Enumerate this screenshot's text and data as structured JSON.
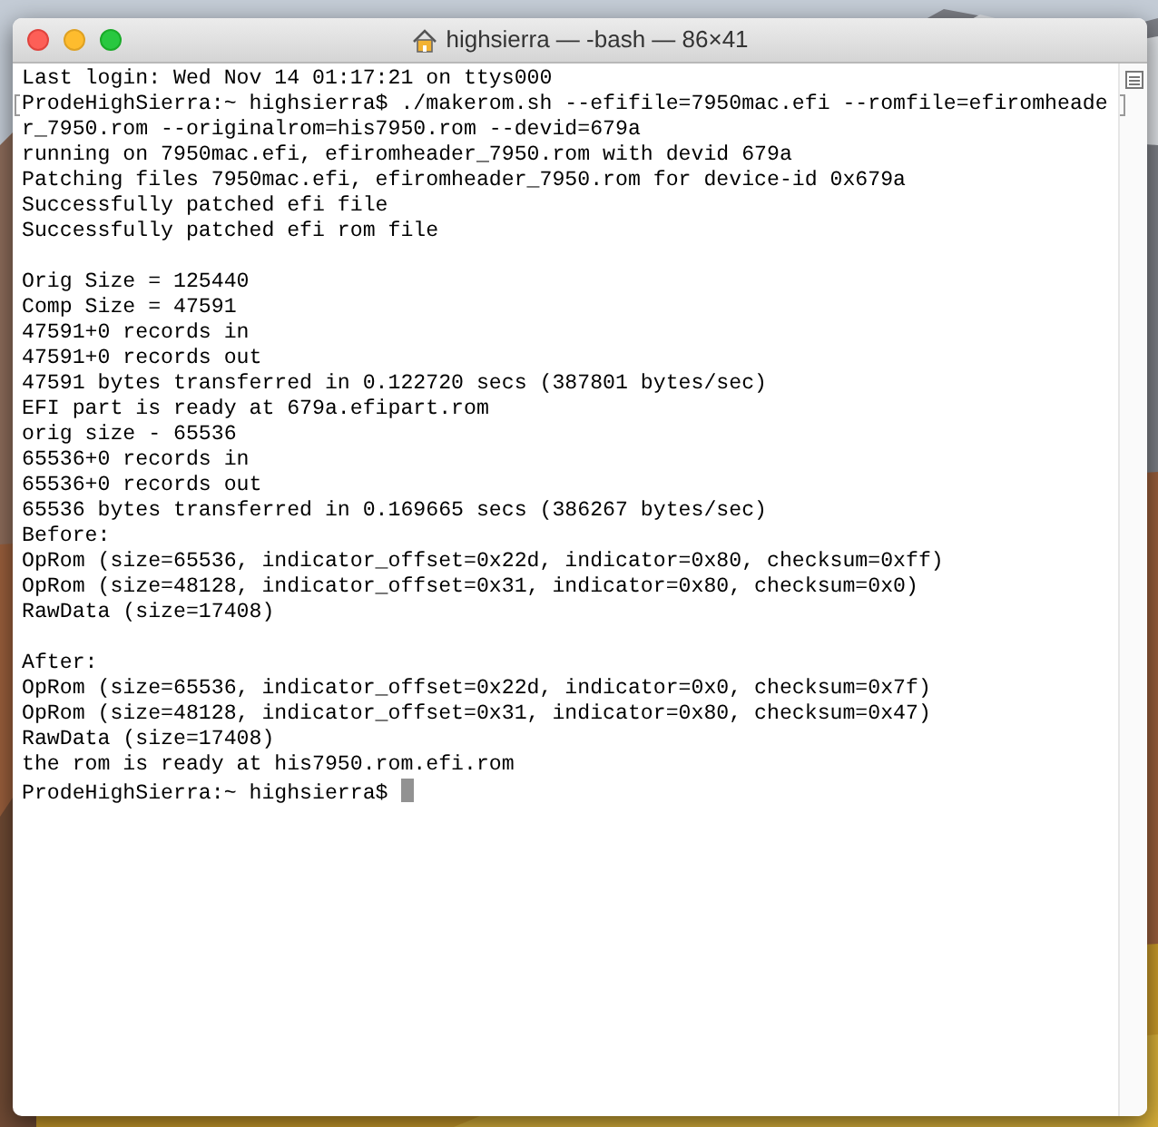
{
  "window": {
    "title": "highsierra — -bash — 86×41"
  },
  "terminal": {
    "lines": [
      {
        "kind": "text",
        "text": "Last login: Wed Nov 14 01:17:21 on ttys000"
      },
      {
        "kind": "text",
        "text": "ProdeHighSierra:~ highsierra$ ./makerom.sh --efifile=7950mac.efi --romfile=efiromheade",
        "marked": true
      },
      {
        "kind": "text",
        "text": "r_7950.rom --originalrom=his7950.rom --devid=679a"
      },
      {
        "kind": "text",
        "text": "running on 7950mac.efi, efiromheader_7950.rom with devid 679a"
      },
      {
        "kind": "text",
        "text": "Patching files 7950mac.efi, efiromheader_7950.rom for device-id 0x679a"
      },
      {
        "kind": "text",
        "text": "Successfully patched efi file"
      },
      {
        "kind": "text",
        "text": "Successfully patched efi rom file"
      },
      {
        "kind": "blank"
      },
      {
        "kind": "text",
        "text": "Orig Size = 125440"
      },
      {
        "kind": "text",
        "text": "Comp Size = 47591"
      },
      {
        "kind": "text",
        "text": "47591+0 records in"
      },
      {
        "kind": "text",
        "text": "47591+0 records out"
      },
      {
        "kind": "text",
        "text": "47591 bytes transferred in 0.122720 secs (387801 bytes/sec)"
      },
      {
        "kind": "text",
        "text": "EFI part is ready at 679a.efipart.rom"
      },
      {
        "kind": "text",
        "text": "orig size - 65536"
      },
      {
        "kind": "text",
        "text": "65536+0 records in"
      },
      {
        "kind": "text",
        "text": "65536+0 records out"
      },
      {
        "kind": "text",
        "text": "65536 bytes transferred in 0.169665 secs (386267 bytes/sec)"
      },
      {
        "kind": "text",
        "text": "Before:"
      },
      {
        "kind": "text",
        "text": "OpRom (size=65536, indicator_offset=0x22d, indicator=0x80, checksum=0xff)"
      },
      {
        "kind": "text",
        "text": "OpRom (size=48128, indicator_offset=0x31, indicator=0x80, checksum=0x0)"
      },
      {
        "kind": "text",
        "text": "RawData (size=17408)"
      },
      {
        "kind": "blank"
      },
      {
        "kind": "text",
        "text": "After:"
      },
      {
        "kind": "text",
        "text": "OpRom (size=65536, indicator_offset=0x22d, indicator=0x0, checksum=0x7f)"
      },
      {
        "kind": "text",
        "text": "OpRom (size=48128, indicator_offset=0x31, indicator=0x80, checksum=0x47)"
      },
      {
        "kind": "text",
        "text": "RawData (size=17408)"
      },
      {
        "kind": "text",
        "text": "the rom is ready at his7950.rom.efi.rom"
      },
      {
        "kind": "text",
        "text": "ProdeHighSierra:~ highsierra$",
        "cursor": true
      }
    ]
  }
}
